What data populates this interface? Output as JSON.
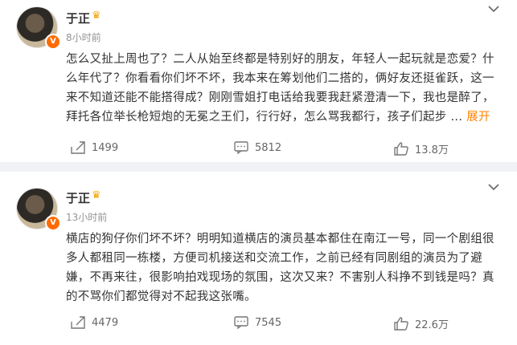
{
  "posts": [
    {
      "author": "于正",
      "time": "8小时前",
      "verified_badge": "V",
      "content": "怎么又扯上周也了？二人从始至终都是特别好的朋友，年轻人一起玩就是恋爱？什么年代了？你看看你们坏不坏，我本来在筹划他们二搭的，俩好友还挺雀跃，这一来不知道还能不能搭得成？刚刚雪姐打电话给我要我赶紧澄清一下，我也是醉了，拜托各位举长枪短炮的无冕之王们，行行好，怎么骂我都行，孩子们起步 ...",
      "expand_label": "展开",
      "repost_count": "1499",
      "comment_count": "5812",
      "like_count": "13.8万"
    },
    {
      "author": "于正",
      "time": "13小时前",
      "verified_badge": "V",
      "content": "横店的狗仔你们坏不坏？明明知道横店的演员基本都住在南江一号，同一个剧组很多人都租同一栋楼，方便司机接送和交流工作，之前已经有同剧组的演员为了避嫌，不再来往，很影响拍戏现场的氛围，这次又来？不害别人科挣不到钱是吗？真的不骂你们都觉得对不起我这张嘴。",
      "expand_label": "",
      "repost_count": "4479",
      "comment_count": "7545",
      "like_count": "22.6万"
    }
  ],
  "icons": {
    "more": "chevron-down-icon",
    "repost": "repost-icon",
    "comment": "comment-icon",
    "like": "thumbs-up-icon",
    "crown": "crown-icon"
  },
  "colors": {
    "accent": "#ff8200",
    "badge": "#ff6b00",
    "crown": "#f4a300"
  }
}
